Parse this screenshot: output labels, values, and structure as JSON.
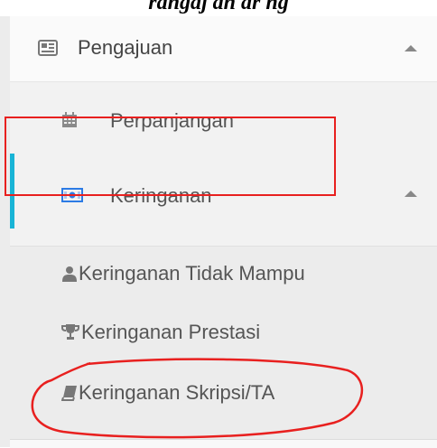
{
  "caption": "rangaj an ar ng",
  "menu": {
    "pengajuan": {
      "label": "Pengajuan",
      "icon": "newspaper-icon",
      "expanded": true
    },
    "perpanjangan": {
      "label": "Perpanjangan",
      "icon": "calendar-icon"
    },
    "keringanan": {
      "label": "Keringanan",
      "icon": "money-icon",
      "expanded": true,
      "active": true
    },
    "sub": [
      {
        "label": "Keringanan Tidak Mampu",
        "icon": "user-icon"
      },
      {
        "label": "Keringanan Prestasi",
        "icon": "trophy-icon"
      },
      {
        "label": "Keringanan Skripsi/TA",
        "icon": "book-icon"
      }
    ]
  },
  "colors": {
    "accent": "#19b4d6",
    "annotation": "#e8201f"
  }
}
